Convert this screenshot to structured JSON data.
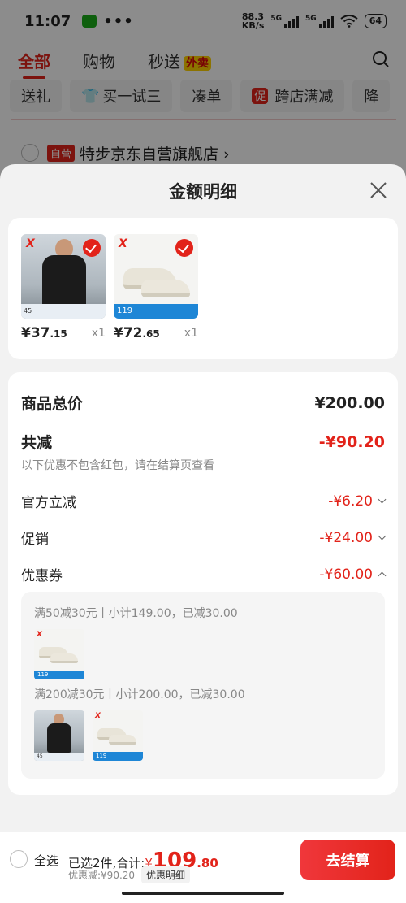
{
  "status_bar": {
    "time": "11:07",
    "dots": "•••",
    "net_speed_value": "88.3",
    "net_speed_unit": "KB/s",
    "sig1": "5G",
    "sig2": "5G",
    "battery": "64"
  },
  "top_nav": {
    "tabs": [
      "全部",
      "购物",
      "秒送"
    ],
    "takeout_badge": "外卖"
  },
  "chips": [
    "送礼",
    "买一试三",
    "凑单",
    "跨店满减",
    "降"
  ],
  "chip_promo_tag": "促",
  "store_row": {
    "tag": "自营",
    "name": "特步京东自营旗舰店 ›"
  },
  "sheet": {
    "title": "金额明细"
  },
  "products": [
    {
      "price_int": "¥37",
      "price_dec": ".15",
      "qty": "x1",
      "strip_text": "45",
      "logo": "X"
    },
    {
      "price_int": "¥72",
      "price_dec": ".65",
      "qty": "x1",
      "band_text": "119",
      "logo": "X"
    }
  ],
  "details": {
    "total_label": "商品总价",
    "total_value": "¥200.00",
    "reduce_label": "共减",
    "reduce_value": "-¥90.20",
    "note": "以下优惠不包含红包，请在结算页查看",
    "official_label": "官方立减",
    "official_value": "-¥6.20",
    "promo_label": "促销",
    "promo_value": "-¥24.00",
    "coupon_label": "优惠券",
    "coupon_value": "-¥60.00"
  },
  "coupons": [
    {
      "text": "满50减30元丨小计149.00，已减30.00"
    },
    {
      "text": "满200减30元丨小计200.00，已减30.00"
    }
  ],
  "bottom_bar": {
    "select_all": "全选",
    "selected_text": "已选2件,合计:",
    "currency": "¥",
    "total_int": "109",
    "total_dec": ".80",
    "discount_text": "优惠减:¥90.20",
    "detail_button": "优惠明细",
    "checkout_button": "去结算"
  },
  "colors": {
    "accent": "#e2231a",
    "checkout_start": "#f0373b"
  }
}
